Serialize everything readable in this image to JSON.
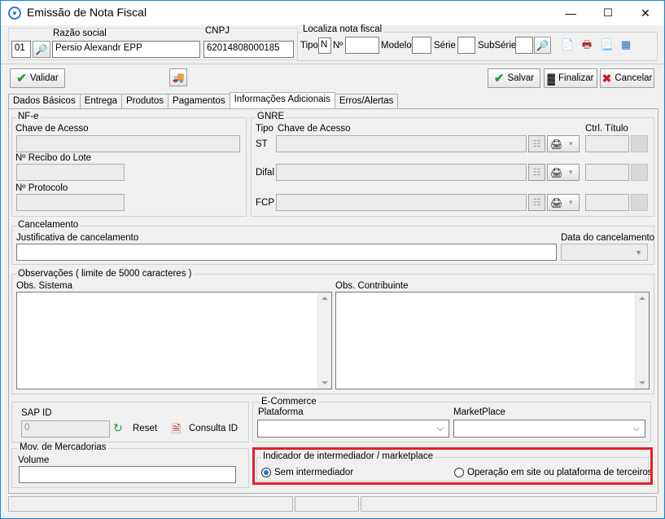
{
  "window": {
    "title": "Emissão de Nota Fiscal",
    "minimize": "—",
    "maximize": "☐",
    "close": "✕"
  },
  "header": {
    "razao_label": "Razão social",
    "cnpj_label": "CNPJ",
    "code_value": "01",
    "razao_value": "Persio Alexandr EPP",
    "cnpj_value": "62014808000185",
    "localiza": {
      "title": "Localiza nota fiscal",
      "tipo_label": "Tipo",
      "tipo_value": "N",
      "numero_label": "Nº",
      "modelo_label": "Modelo",
      "serie_label": "Série",
      "subserie_label": "SubSérie"
    }
  },
  "toolbar": {
    "validar": "Validar",
    "salvar": "Salvar",
    "finalizar": "Finalizar",
    "cancelar": "Cancelar"
  },
  "tabs": [
    "Dados Básicos",
    "Entrega",
    "Produtos",
    "Pagamentos",
    "Informações Adicionais",
    "Erros/Alertas"
  ],
  "active_tab": "Informações Adicionais",
  "nfe": {
    "title": "NF-e",
    "chave_label": "Chave de Acesso",
    "recibo_label": "Nº Recibo do Lote",
    "protocolo_label": "Nº Protocolo"
  },
  "gnre": {
    "title": "GNRE",
    "tipo_label": "Tipo",
    "chave_label": "Chave de Acesso",
    "ctrl_label": "Ctrl. Título",
    "rows": [
      "ST",
      "Difal",
      "FCP"
    ]
  },
  "cancelamento": {
    "title": "Cancelamento",
    "justificativa_label": "Justificativa de cancelamento",
    "data_label": "Data do cancelamento"
  },
  "observacoes": {
    "title": "Observações ( limite de 5000 caracteres )",
    "sistema_label": "Obs. Sistema",
    "contribuinte_label": "Obs. Contribuinte"
  },
  "sap": {
    "label": "SAP ID",
    "value": "0",
    "reset": "Reset",
    "consulta": "Consulta ID"
  },
  "mov": {
    "title": "Mov. de Mercadorias",
    "volume_label": "Volume"
  },
  "ecommerce": {
    "title": "E-Commerce",
    "plataforma_label": "Plataforma",
    "marketplace_label": "MarketPlace"
  },
  "intermediador": {
    "title": "Indicador de intermediador / marketplace",
    "option1": "Sem intermediador",
    "option2": "Operação em site ou plataforma de terceiros",
    "selected": "Sem intermediador"
  },
  "colors": {
    "accent": "#1a73d9",
    "highlight": "#e3202a",
    "ok": "#2a9d2a",
    "cancel": "#c71f1f"
  },
  "icons": [
    "app-icon",
    "search-icon",
    "printer-icon",
    "truck-icon",
    "check-icon",
    "cancel-icon",
    "calendar-icon",
    "grid-icon"
  ]
}
